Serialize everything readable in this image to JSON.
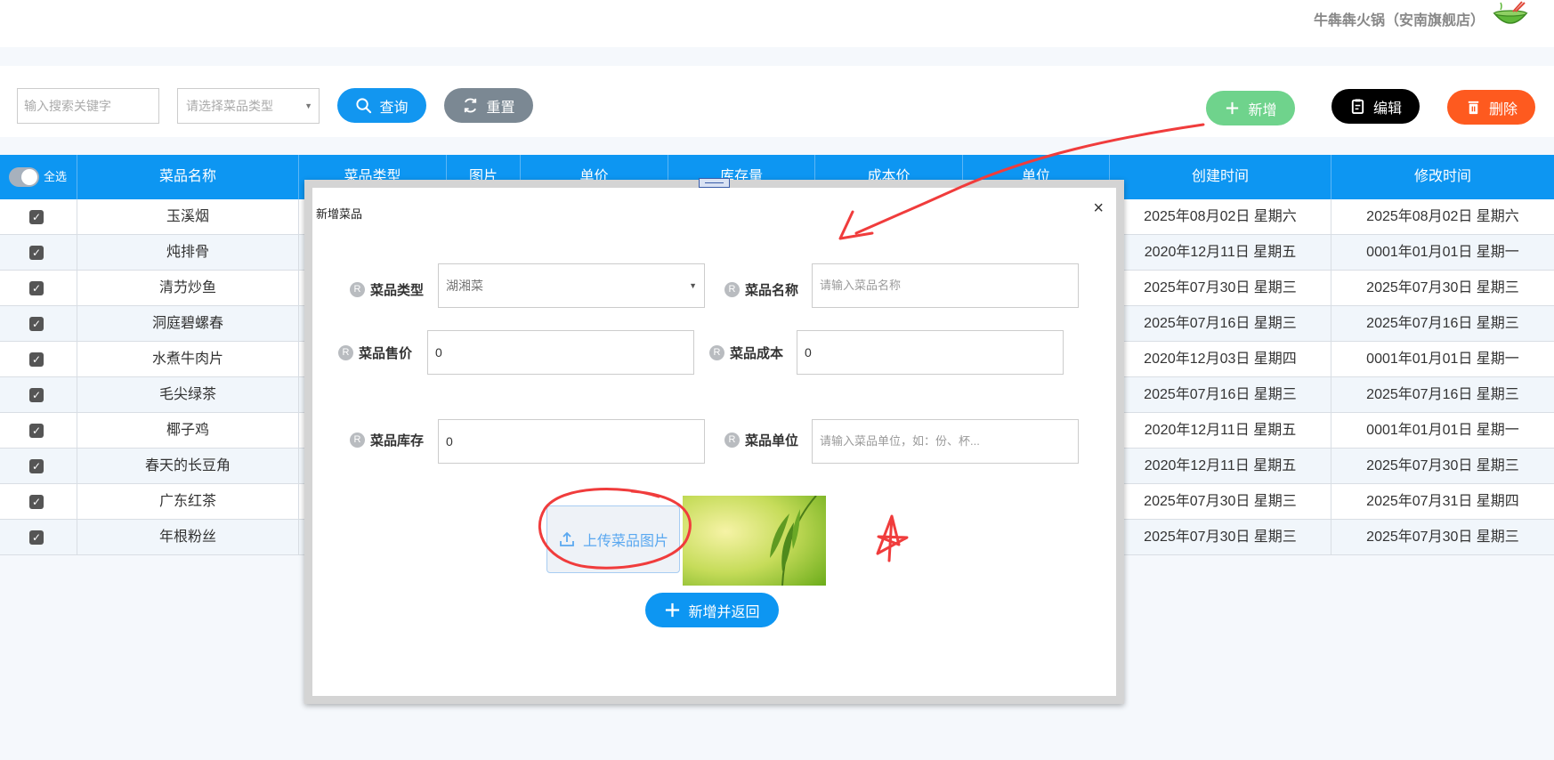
{
  "header": {
    "store_name": "牛犇犇火锅（安南旗舰店）",
    "logo_icon": "hotpot-bowl-icon"
  },
  "toolbar": {
    "search_placeholder": "输入搜索关键字",
    "type_placeholder": "请选择菜品类型",
    "query_label": "查询",
    "reset_label": "重置",
    "add_label": "新增",
    "edit_label": "编辑",
    "delete_label": "删除"
  },
  "colors": {
    "primary": "#0d96f2",
    "add": "#6fd38c",
    "edit": "#000000",
    "delete": "#fe5a1f",
    "reset": "#7b8893",
    "annotation": "#f03c3c"
  },
  "table": {
    "select_all_label": "全选",
    "headers": [
      "菜品名称",
      "菜品类型",
      "图片",
      "单价",
      "库存量",
      "成本价",
      "单位",
      "创建时间",
      "修改时间"
    ],
    "rows": [
      {
        "name": "玉溪烟",
        "created": "2025年08月02日 星期六",
        "modified": "2025年08月02日 星期六"
      },
      {
        "name": "炖排骨",
        "created": "2020年12月11日 星期五",
        "modified": "0001年01月01日 星期一"
      },
      {
        "name": "清芀炒鱼",
        "created": "2025年07月30日 星期三",
        "modified": "2025年07月30日 星期三"
      },
      {
        "name": "洞庭碧螺春",
        "created": "2025年07月16日 星期三",
        "modified": "2025年07月16日 星期三"
      },
      {
        "name": "水煮牛肉片",
        "created": "2020年12月03日 星期四",
        "modified": "0001年01月01日 星期一"
      },
      {
        "name": "毛尖绿茶",
        "created": "2025年07月16日 星期三",
        "modified": "2025年07月16日 星期三"
      },
      {
        "name": "椰子鸡",
        "created": "2020年12月11日 星期五",
        "modified": "0001年01月01日 星期一"
      },
      {
        "name": "春天的长豆角",
        "created": "2020年12月11日 星期五",
        "modified": "2025年07月30日 星期三"
      },
      {
        "name": "广东红茶",
        "created": "2025年07月30日 星期三",
        "modified": "2025年07月31日 星期四"
      },
      {
        "name": "年根粉丝",
        "created": "2025年07月30日 星期三",
        "modified": "2025年07月30日 星期三"
      }
    ]
  },
  "modal": {
    "title": "新增菜品",
    "close": "×",
    "type_label": "菜品类型",
    "type_value": "湖湘菜",
    "name_label": "菜品名称",
    "name_placeholder": "请输入菜品名称",
    "price_label": "菜品售价",
    "price_value": "0",
    "cost_label": "菜品成本",
    "cost_value": "0",
    "stock_label": "菜品库存",
    "stock_value": "0",
    "unit_label": "菜品单位",
    "unit_placeholder": "请输入菜品单位，如：份、杯...",
    "upload_label": "上传菜品图片",
    "submit_label": "新增并返回",
    "required_mark": "R"
  }
}
